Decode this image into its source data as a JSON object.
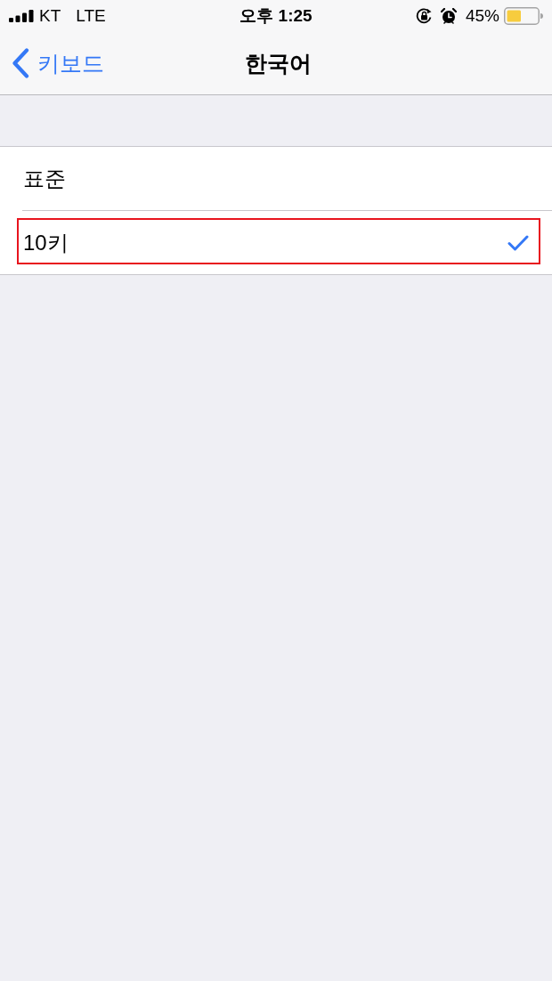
{
  "status_bar": {
    "carrier": "KT",
    "network": "LTE",
    "time": "오후 1:25",
    "battery_text": "45%"
  },
  "nav_bar": {
    "back_label": "키보드",
    "title": "한국어"
  },
  "options": [
    {
      "label": "표준",
      "selected": false,
      "highlighted": false
    },
    {
      "label": "10키",
      "selected": true,
      "highlighted": true
    }
  ]
}
